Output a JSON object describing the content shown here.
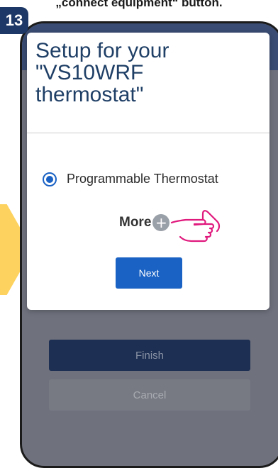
{
  "caption": "„connect equipment“ button.",
  "step_number": "13",
  "dialog": {
    "title": "Setup for your \"VS10WRF thermostat\"",
    "radio_option": "Programmable Thermostat",
    "more_label": "More",
    "next_label": "Next"
  },
  "background_buttons": {
    "finish_label": "Finish",
    "cancel_label": "Cancel"
  },
  "colors": {
    "accent_blue": "#1a62c4",
    "title_blue": "#1f3f66",
    "badge_navy": "#1d3866",
    "arrow_yellow": "#fdd25e",
    "hand_magenta": "#e0197d"
  },
  "icons": {
    "radio": "radio-selected-icon",
    "plus": "plus-circle-icon",
    "pointer": "pointing-hand-icon"
  }
}
